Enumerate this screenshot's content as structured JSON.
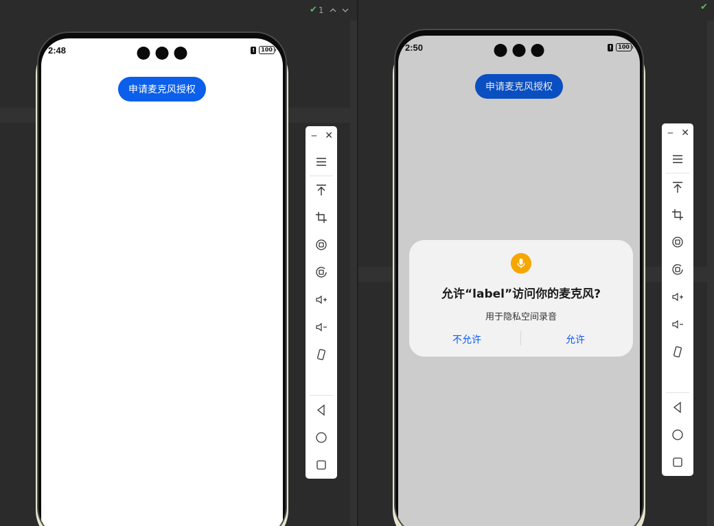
{
  "ide": {
    "left_status": {
      "warning_count": "1"
    },
    "colors": {
      "background": "#2b2b2b",
      "check": "#5fb865"
    }
  },
  "left_device": {
    "status_time": "2:48",
    "battery": "100",
    "request_button": "申请麦克风授权"
  },
  "right_device": {
    "status_time": "2:50",
    "battery": "100",
    "request_button": "申请麦克风授权",
    "dialog": {
      "icon": "microphone-icon",
      "title": "允许“label”访问你的麦克风?",
      "subtitle": "用于隐私空间录音",
      "deny": "不允许",
      "allow": "允许"
    }
  },
  "toolbar_items": [
    "minimize-icon",
    "close-icon",
    "menu-icon",
    "pin-to-top-icon",
    "crop-icon",
    "rotate-left-icon",
    "rotate-right-icon",
    "volume-up-icon",
    "volume-down-icon",
    "shake-icon",
    "back-icon",
    "home-icon",
    "recents-icon"
  ],
  "colors": {
    "accent": "#0b5fea",
    "dialog_button": "#0a59f7",
    "mic_icon_bg": "#f5a700"
  }
}
